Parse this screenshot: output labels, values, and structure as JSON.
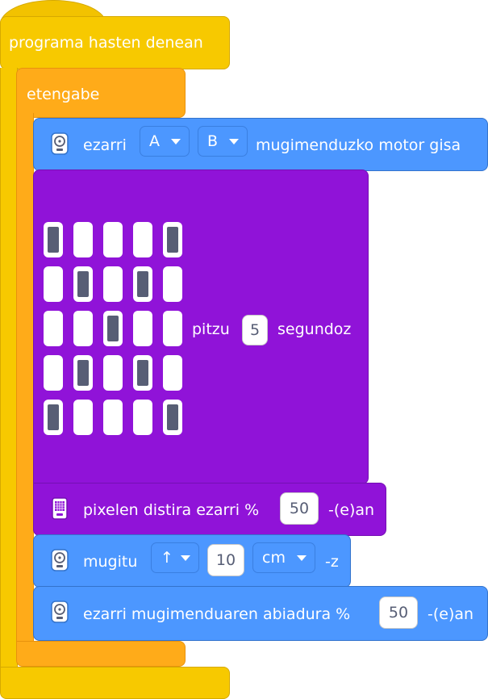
{
  "hat_label": "programa hasten denean",
  "forever_label": "etengabe",
  "motor_block": {
    "label_set": "ezarri",
    "port_a": "A",
    "port_b": "B",
    "label_suffix": "mugimenduzko motor gisa",
    "icon": "robot-icon"
  },
  "light_block": {
    "pattern": [
      [
        1,
        0,
        0,
        0,
        1
      ],
      [
        0,
        1,
        0,
        1,
        0
      ],
      [
        0,
        0,
        1,
        0,
        0
      ],
      [
        0,
        1,
        0,
        1,
        0
      ],
      [
        1,
        0,
        0,
        0,
        1
      ]
    ],
    "label_light": "pitzu",
    "seconds": "5",
    "label_seconds": "segundoz"
  },
  "brightness_block": {
    "label": "pixelen distira ezarri %",
    "value": "50",
    "suffix": "-(e)an",
    "icon": "display-icon"
  },
  "move_block": {
    "label": "mugitu",
    "direction": "↑",
    "distance": "10",
    "unit": "cm",
    "suffix": "-z",
    "icon": "robot-icon"
  },
  "speed_block": {
    "label": "ezarri mugimenduaren abiadura %",
    "value": "50",
    "suffix": "-(e)an",
    "icon": "robot-icon"
  },
  "colors": {
    "yellow": "#f7c900",
    "orange": "#ffab19",
    "blue": "#4c97ff",
    "purple": "#9013d8"
  }
}
